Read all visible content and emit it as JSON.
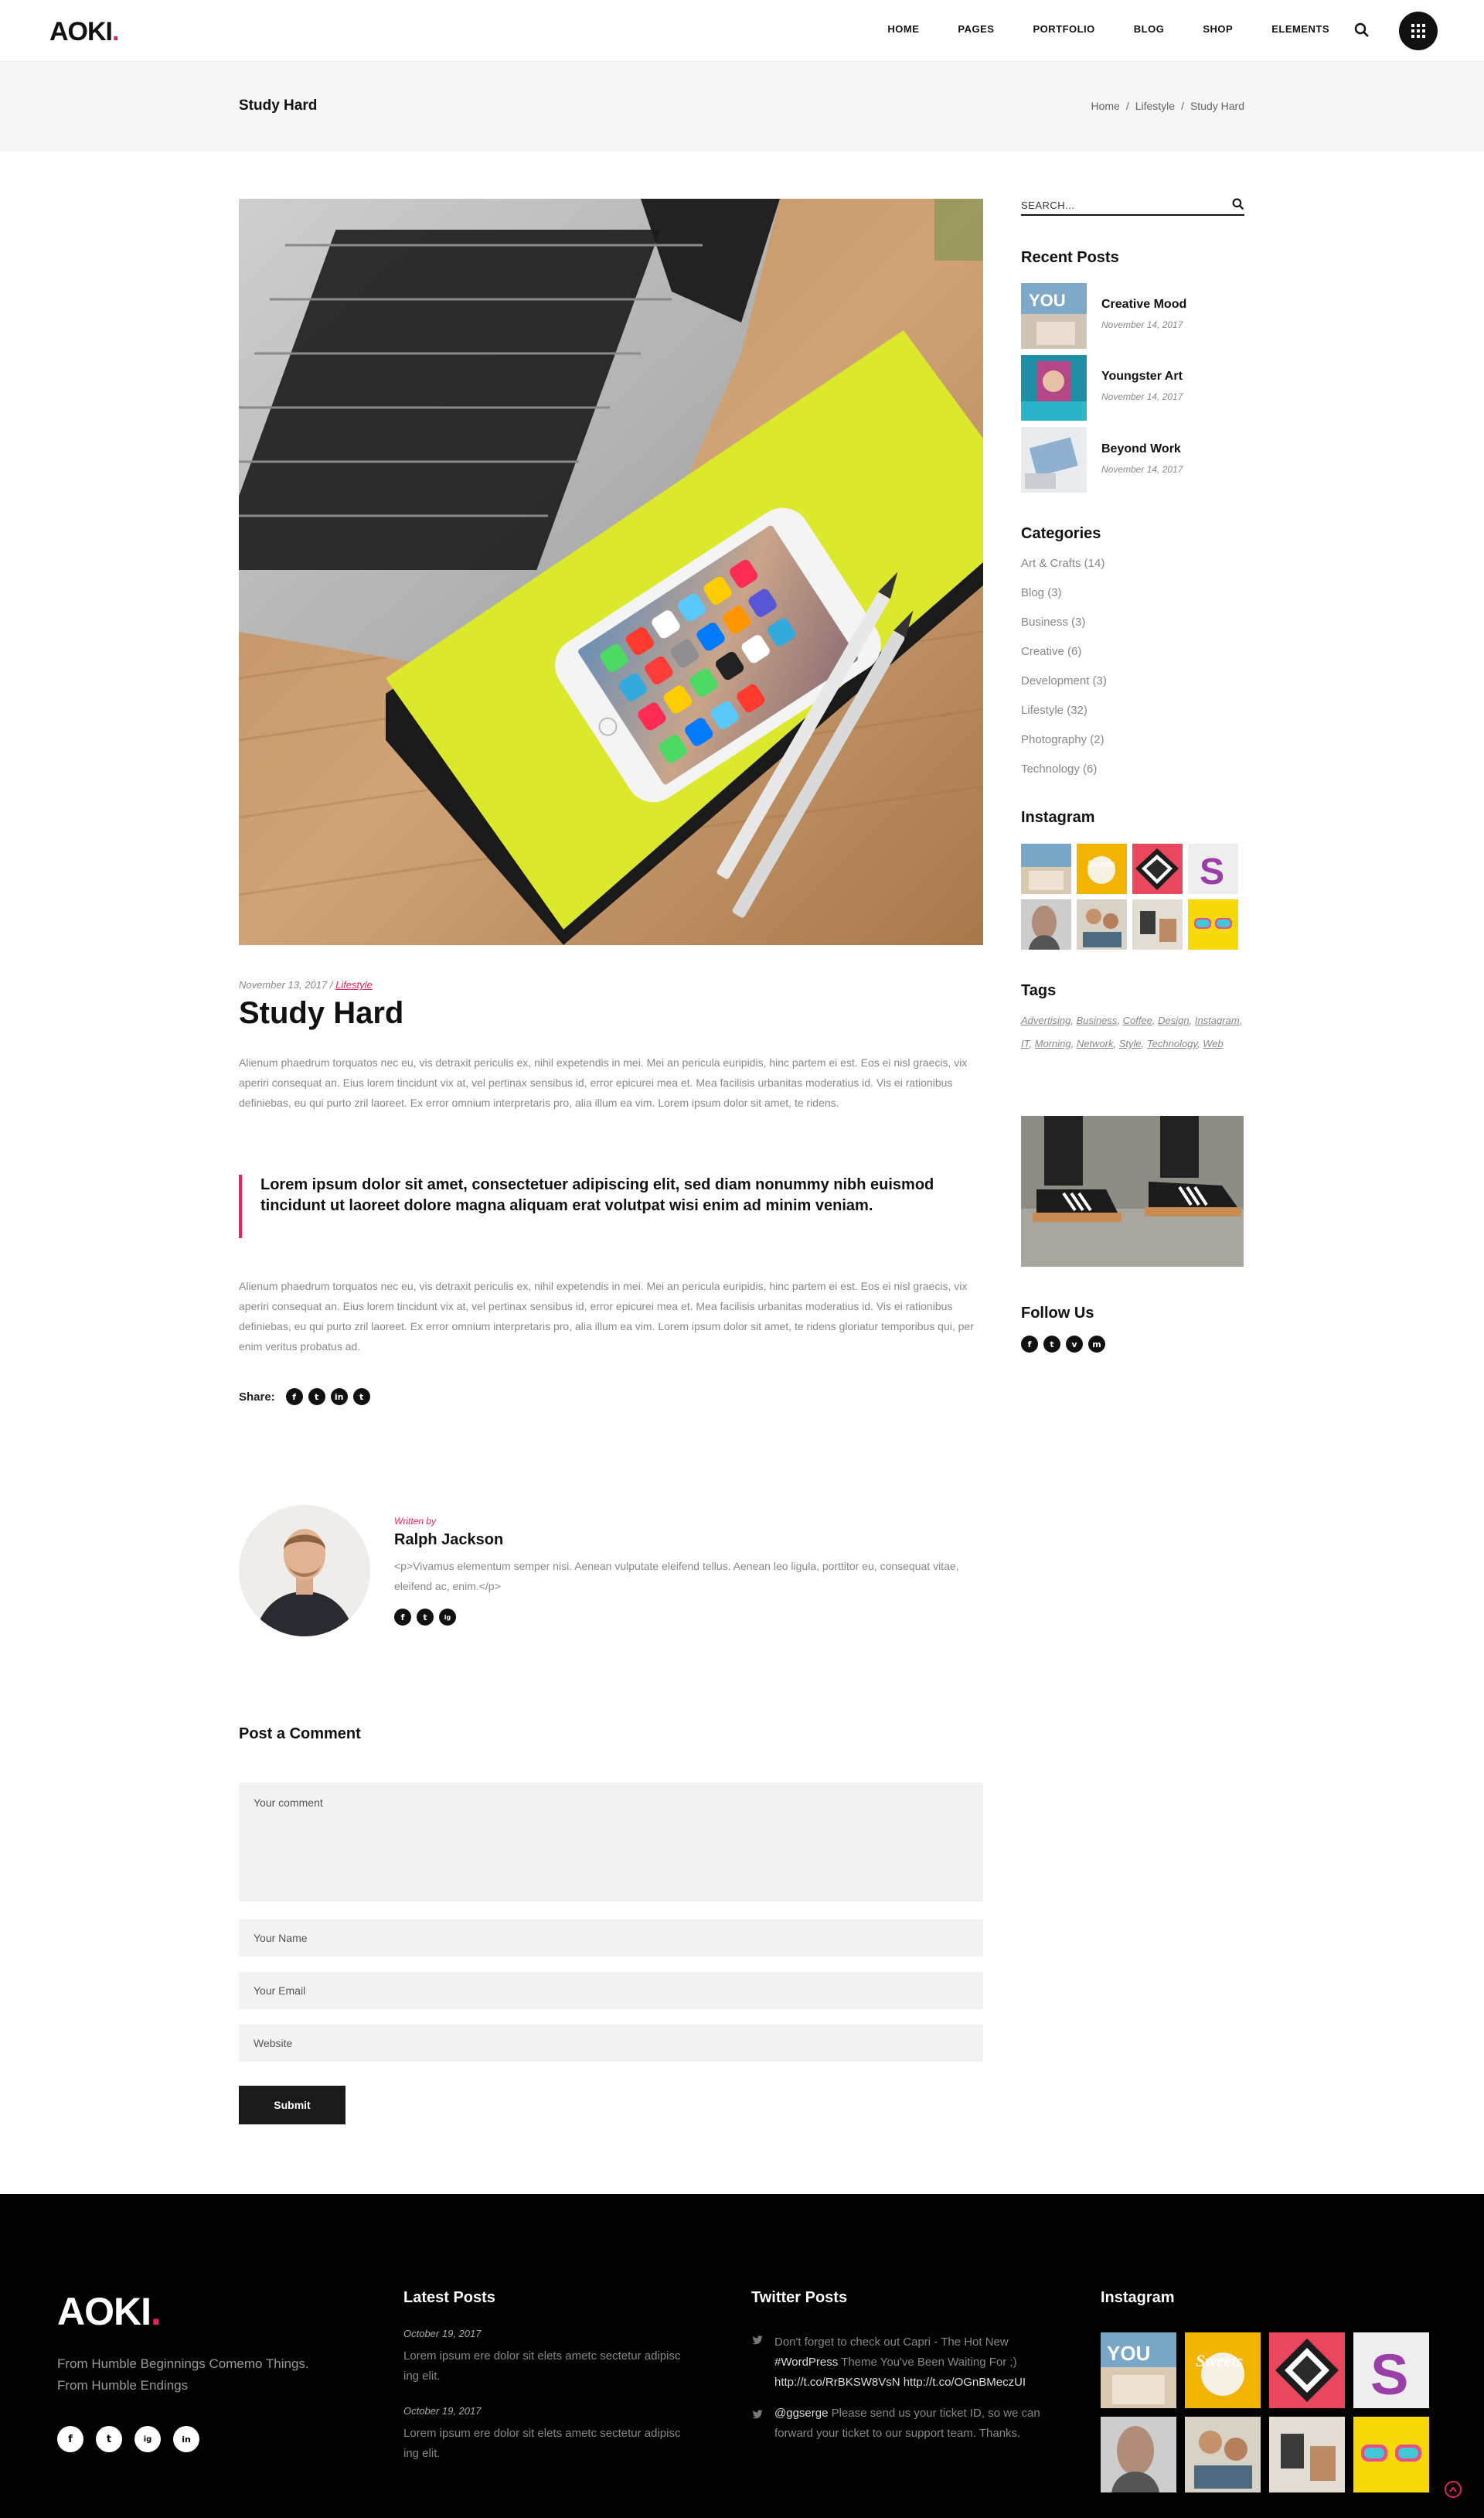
{
  "header": {
    "logo": "AOKI",
    "logo_dot": ".",
    "nav": [
      "HOME",
      "PAGES",
      "PORTFOLIO",
      "BLOG",
      "SHOP",
      "ELEMENTS"
    ]
  },
  "titlebar": {
    "title": "Study Hard",
    "breadcrumb": [
      "Home",
      "Lifestyle",
      "Study Hard"
    ],
    "sep": "/"
  },
  "post": {
    "date": "November 13, 2017",
    "date_sep": "/",
    "category": "Lifestyle",
    "title": "Study Hard",
    "para1": "Alienum phaedrum torquatos nec eu, vis detraxit periculis ex, nihil expetendis in mei. Mei an pericula euripidis, hinc partem ei est. Eos ei nisl graecis, vix aperiri consequat an. Eius lorem tincidunt vix at, vel pertinax sensibus id, error epicurei mea et. Mea facilisis urbanitas moderatius id. Vis ei rationibus definiebas, eu qui purto zril laoreet. Ex error omnium interpretaris pro, alia illum ea vim. Lorem ipsum dolor sit amet, te ridens.",
    "quote": "Lorem ipsum dolor sit amet, consectetuer adipiscing elit, sed diam nonummy nibh euismod tincidunt ut laoreet dolore magna aliquam erat volutpat wisi enim ad minim veniam.",
    "para2": "Alienum phaedrum torquatos nec eu, vis detraxit periculis ex, nihil expetendis in mei. Mei an pericula euripidis, hinc partem ei est. Eos ei nisl graecis, vix aperiri consequat an. Eius lorem tincidunt vix at, vel pertinax sensibus id, error epicurei mea et. Mea facilisis urbanitas moderatius id. Vis ei rationibus definiebas, eu qui purto zril laoreet. Ex error omnium interpretaris pro, alia illum ea vim. Lorem ipsum dolor sit amet, te ridens gloriatur temporibus qui, per enim veritus probatus ad.",
    "share_label": "Share:",
    "share_icons": [
      "f",
      "t",
      "in",
      "t"
    ]
  },
  "author": {
    "written_by": "Written by",
    "name": "Ralph Jackson",
    "bio": "<p>Vivamus elementum semper nisi. Aenean vulputate eleifend tellus. Aenean leo ligula, porttitor eu, consequat vitae, eleifend ac, enim.</p>",
    "social_icons": [
      "f",
      "t",
      "ig"
    ]
  },
  "comment_form": {
    "title": "Post a Comment",
    "comment_placeholder": "Your comment",
    "name_placeholder": "Your Name",
    "email_placeholder": "Your Email",
    "website_placeholder": "Website",
    "submit_label": "Submit"
  },
  "sidebar": {
    "search_placeholder": "SEARCH...",
    "recent_title": "Recent Posts",
    "recent": [
      {
        "title": "Creative Mood",
        "date": "November 14, 2017"
      },
      {
        "title": "Youngster Art",
        "date": "November 14, 2017"
      },
      {
        "title": "Beyond Work",
        "date": "November 14, 2017"
      }
    ],
    "categories_title": "Categories",
    "categories": [
      "Art & Crafts (14)",
      "Blog (3)",
      "Business (3)",
      "Creative (6)",
      "Development (3)",
      "Lifestyle (32)",
      "Photography (2)",
      "Technology (6)"
    ],
    "instagram_title": "Instagram",
    "tags_title": "Tags",
    "tags": [
      "Advertising",
      "Business",
      "Coffee",
      "Design",
      "Instagram",
      "IT",
      "Morning",
      "Network",
      "Style",
      "Technology",
      "Web"
    ],
    "tag_sep": ",",
    "follow_title": "Follow Us",
    "follow_icons": [
      "f",
      "t",
      "v",
      "m"
    ]
  },
  "footer": {
    "logo": "AOKI",
    "logo_dot": ".",
    "tagline": "From Humble Beginnings Comemo Things. From Humble Endings",
    "social_icons": [
      "f",
      "t",
      "ig",
      "in"
    ],
    "latest_title": "Latest Posts",
    "latest": [
      {
        "date": "October 19, 2017",
        "text": "Lorem ipsum ere dolor sit elets ametc sectetur adipisc ing elit."
      },
      {
        "date": "October 19, 2017",
        "text": "Lorem ipsum ere dolor sit elets ametc sectetur adipisc ing elit."
      }
    ],
    "twitter_title": "Twitter Posts",
    "tweet1_a": "Don't forget to check out Capri - The Hot New ",
    "tweet1_b": "#WordPress",
    "tweet1_c": " Theme You've Been Waiting For ;) ",
    "tweet1_d": "http://t.co/RrBKSW8VsN http://t.co/OGnBMeczUI",
    "tweet2_a": "@ggserge",
    "tweet2_b": " Please send us your ticket ID, so we can forward your ticket to our support team. Thanks.",
    "instagram_title": "Instagram"
  },
  "colors": {
    "accent": "#e5245e",
    "dark": "#111111",
    "footer_bg": "#000000"
  }
}
